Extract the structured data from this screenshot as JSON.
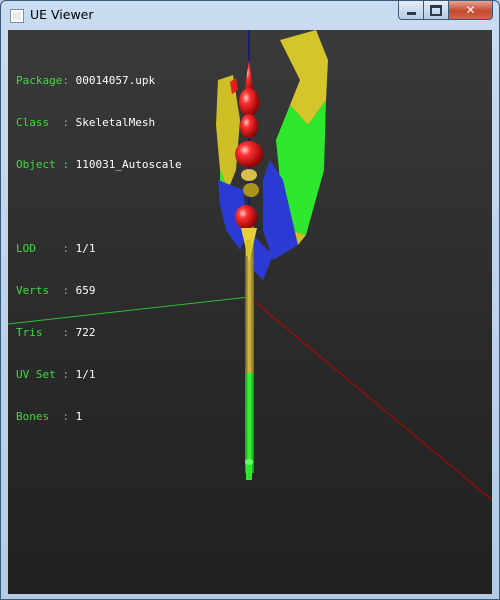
{
  "window": {
    "title": "UE Viewer",
    "controls": {
      "minimize": "minimize",
      "maximize": "maximize",
      "close": "close"
    }
  },
  "info": {
    "package": {
      "label": "Package",
      "value": "00014057.upk"
    },
    "class": {
      "label": "Class  ",
      "value": "SkeletalMesh"
    },
    "object": {
      "label": "Object ",
      "value": "110031_Autoscale"
    },
    "lod": {
      "label": "LOD    ",
      "value": "1/1"
    },
    "verts": {
      "label": "Verts  ",
      "value": "659"
    },
    "tris": {
      "label": "Tris   ",
      "value": "722"
    },
    "uvset": {
      "label": "UV Set ",
      "value": "1/1"
    },
    "bones": {
      "label": "Bones  ",
      "value": "1"
    }
  },
  "colors": {
    "label": "#3ddc3d",
    "value": "#ffffff",
    "axis_x": "#c00000",
    "axis_y": "#2fbf2f",
    "axis_z": "#0000c0"
  }
}
